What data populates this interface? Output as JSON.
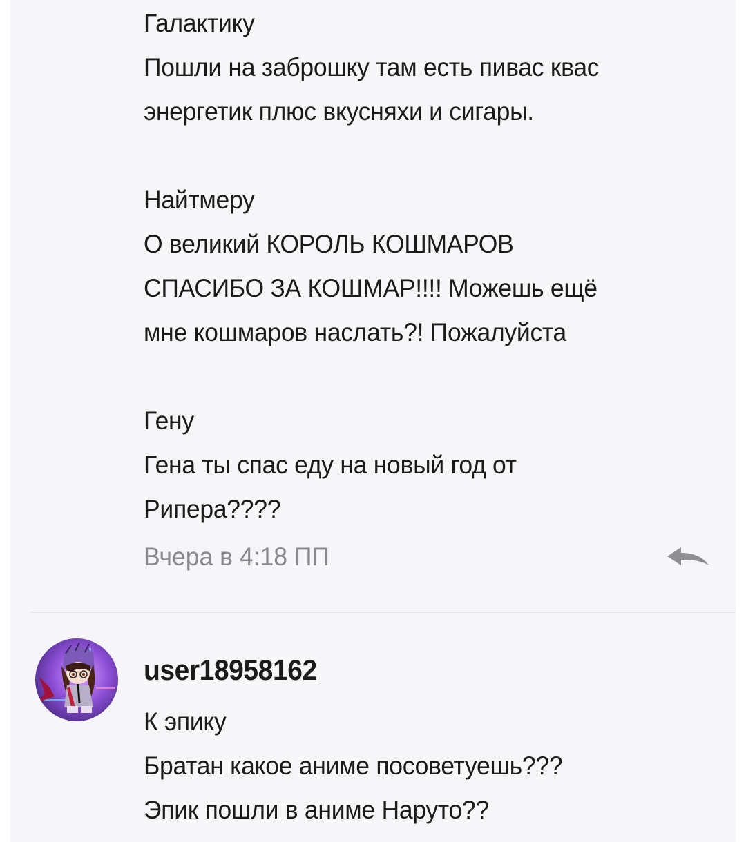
{
  "comment_1": {
    "lines": [
      "Галактику",
      "Пошли на заброшку там есть пивас квас",
      "энергетик плюс вкусняхи и сигары.",
      "",
      "Найтмеру",
      "О великий КОРОЛЬ КОШМАРОВ",
      "СПАСИБО ЗА КОШМАР!!!! Можешь ещё",
      "мне кошмаров наслать?! Пожалуйста",
      "",
      "Гену",
      "Гена ты спас еду на новый год от",
      "Рипера????"
    ],
    "timestamp": "Вчера в 4:18 ПП",
    "reply_icon": "reply-arrow-icon"
  },
  "comment_2": {
    "username": "user18958162",
    "avatar_icon": "anime-character-avatar",
    "lines": [
      "К эпику",
      "Братан какое аниме посоветуешь???",
      "Эпик пошли в аниме Наруто??"
    ]
  },
  "colors": {
    "panel_background": "#f6f5f7",
    "text": "#1b1b1b",
    "timestamp": "#8a8a8e",
    "reply_icon": "#8e8e93",
    "divider": "#e6e5e9"
  }
}
